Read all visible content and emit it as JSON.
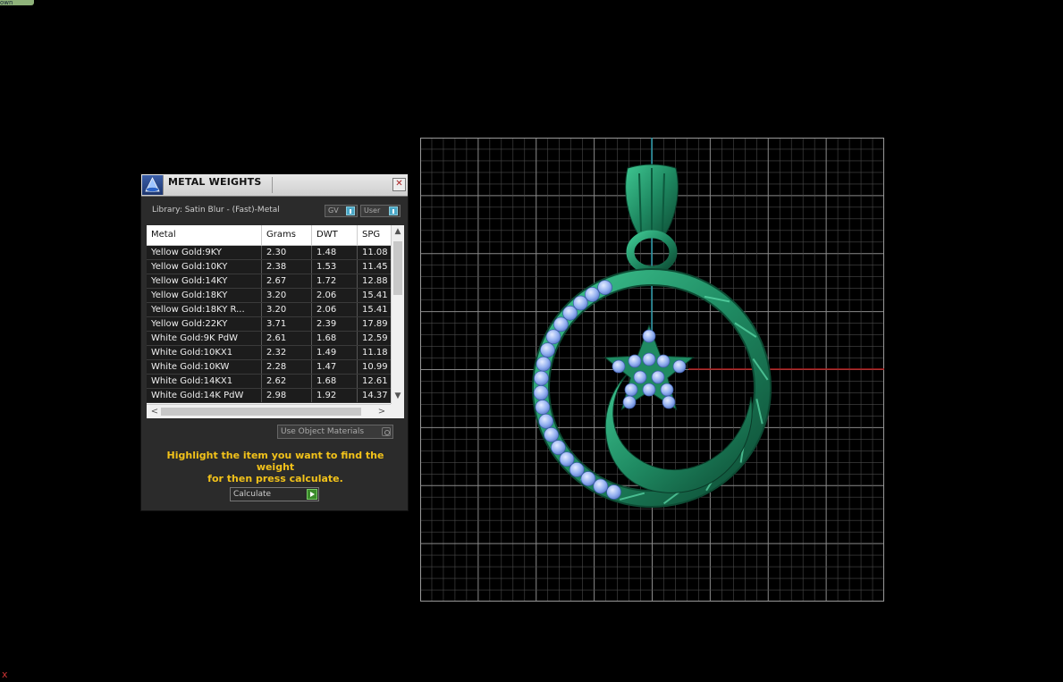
{
  "corner_tab": "own",
  "corner_close": "x",
  "panel": {
    "title": "METAL WEIGHTS",
    "close_glyph": "✕",
    "library_label": "Library: Satin Blur - (Fast)-Metal",
    "toggle_gv": "GV",
    "toggle_user": "User",
    "columns": [
      "Metal",
      "Grams",
      "DWT",
      "SPG"
    ],
    "rows": [
      [
        "Yellow Gold:9KY",
        "2.30",
        "1.48",
        "11.08"
      ],
      [
        "Yellow Gold:10KY",
        "2.38",
        "1.53",
        "11.45"
      ],
      [
        "Yellow Gold:14KY",
        "2.67",
        "1.72",
        "12.88"
      ],
      [
        "Yellow Gold:18KY",
        "3.20",
        "2.06",
        "15.41"
      ],
      [
        "Yellow Gold:18KY R...",
        "3.20",
        "2.06",
        "15.41"
      ],
      [
        "Yellow Gold:22KY",
        "3.71",
        "2.39",
        "17.89"
      ],
      [
        "White Gold:9K PdW",
        "2.61",
        "1.68",
        "12.59"
      ],
      [
        "White Gold:10KX1",
        "2.32",
        "1.49",
        "11.18"
      ],
      [
        "White Gold:10KW",
        "2.28",
        "1.47",
        "10.99"
      ],
      [
        "White Gold:14KX1",
        "2.62",
        "1.68",
        "12.61"
      ],
      [
        "White Gold:14K PdW",
        "2.98",
        "1.92",
        "14.37"
      ]
    ],
    "use_object_materials": "Use Object Materials",
    "hint_line1": "Highlight the item you want to find the weight",
    "hint_line2": "for then press calculate.",
    "calculate_label": "Calculate"
  },
  "colors": {
    "background": "#000000",
    "grid": "#6a6a6a",
    "axis_vertical": "#1f8fa0",
    "axis_horizontal": "#b01818",
    "metal": "#1f8a62",
    "gem": "#93b0f0",
    "hint": "#f2c21a"
  },
  "viewport": {
    "icon": "pendant-render",
    "axes": [
      "vertical-axis-icon",
      "horizontal-axis-icon"
    ]
  }
}
